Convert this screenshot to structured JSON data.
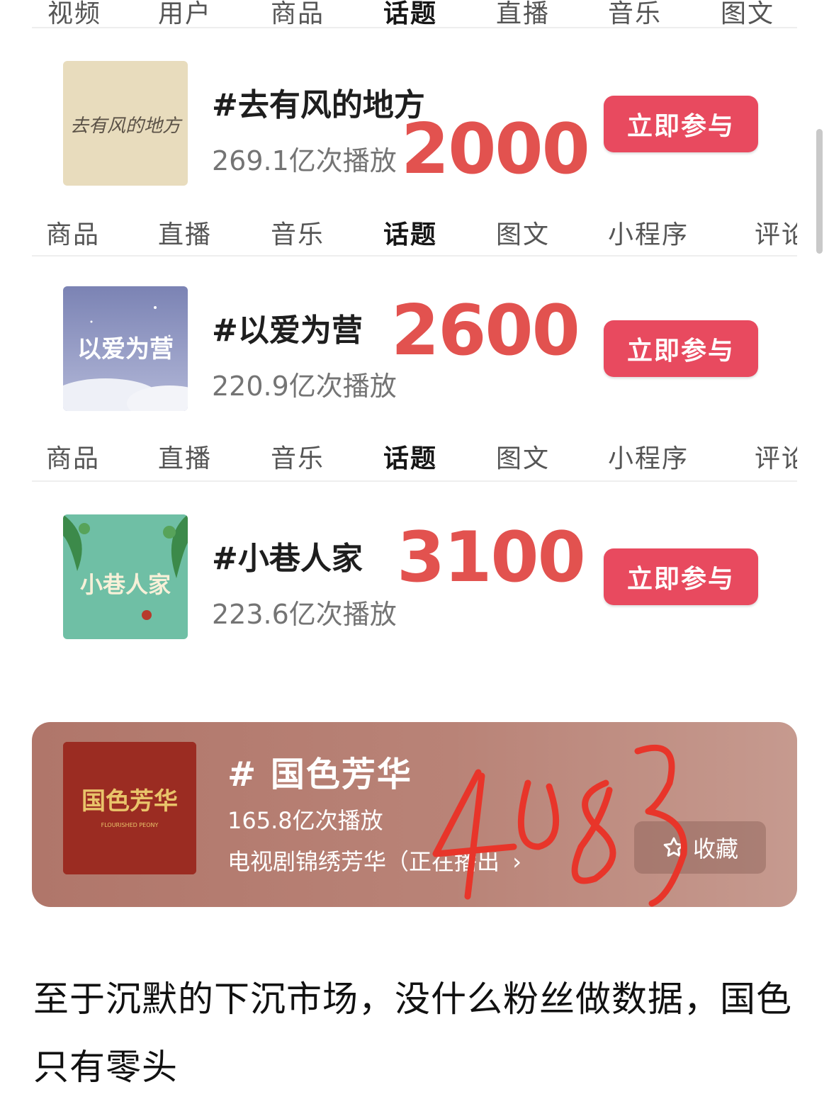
{
  "tabstrips": [
    {
      "items": [
        "视频",
        "用户",
        "商品",
        "话题",
        "直播",
        "音乐",
        "图文"
      ],
      "active_index": 3
    },
    {
      "items": [
        "商品",
        "直播",
        "音乐",
        "话题",
        "图文",
        "小程序",
        "评论"
      ],
      "active_index": 3
    },
    {
      "items": [
        "商品",
        "直播",
        "音乐",
        "话题",
        "图文",
        "小程序",
        "评论"
      ],
      "active_index": 3
    }
  ],
  "topics": [
    {
      "title": "#去有风的地方",
      "plays": "269.1亿次播放",
      "annotation": "2000",
      "button": "立即参与",
      "cover_text": "去有风的地方"
    },
    {
      "title": "#以爱为营",
      "plays": "220.9亿次播放",
      "annotation": "2600",
      "button": "立即参与",
      "cover_text": "以爱为营"
    },
    {
      "title": "#小巷人家",
      "plays": "223.6亿次播放",
      "annotation": "3100",
      "button": "立即参与",
      "cover_text": "小巷人家"
    }
  ],
  "featured": {
    "title": "# 国色芳华",
    "plays": "165.8亿次播放",
    "link": "电视剧锦绣芳华（正在播出",
    "favorite_label": "收藏",
    "handwritten_annotation": "4083",
    "cover_text": "国色芳华",
    "cover_subtitle": "FLOURISHED PEONY"
  },
  "caption": "至于沉默的下沉市场，没什么粉丝做数据，国色只有零头",
  "colors": {
    "accent": "#e84a5f",
    "annotation": "#e2524f",
    "handwriting": "#e8352a",
    "card": "#b98377"
  }
}
